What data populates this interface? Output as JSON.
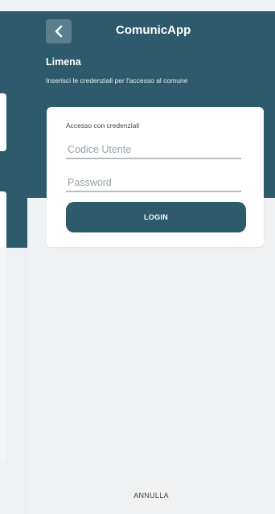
{
  "header": {
    "app_title": "ComunicApp",
    "org_name": "Limena",
    "subtitle": "Inserisci le credenziali per l'accesso al comune",
    "back_icon": "chevron-left-icon"
  },
  "login_card": {
    "heading": "Accesso con credenziali",
    "username_placeholder": "Codice Utente",
    "username_value": "",
    "password_placeholder": "Password",
    "password_value": "",
    "login_label": "LOGIN"
  },
  "footer": {
    "cancel_label": "ANNULLA"
  },
  "colors": {
    "primary": "#2e5b6c",
    "background": "#f0f2f4",
    "card": "#ffffff"
  }
}
